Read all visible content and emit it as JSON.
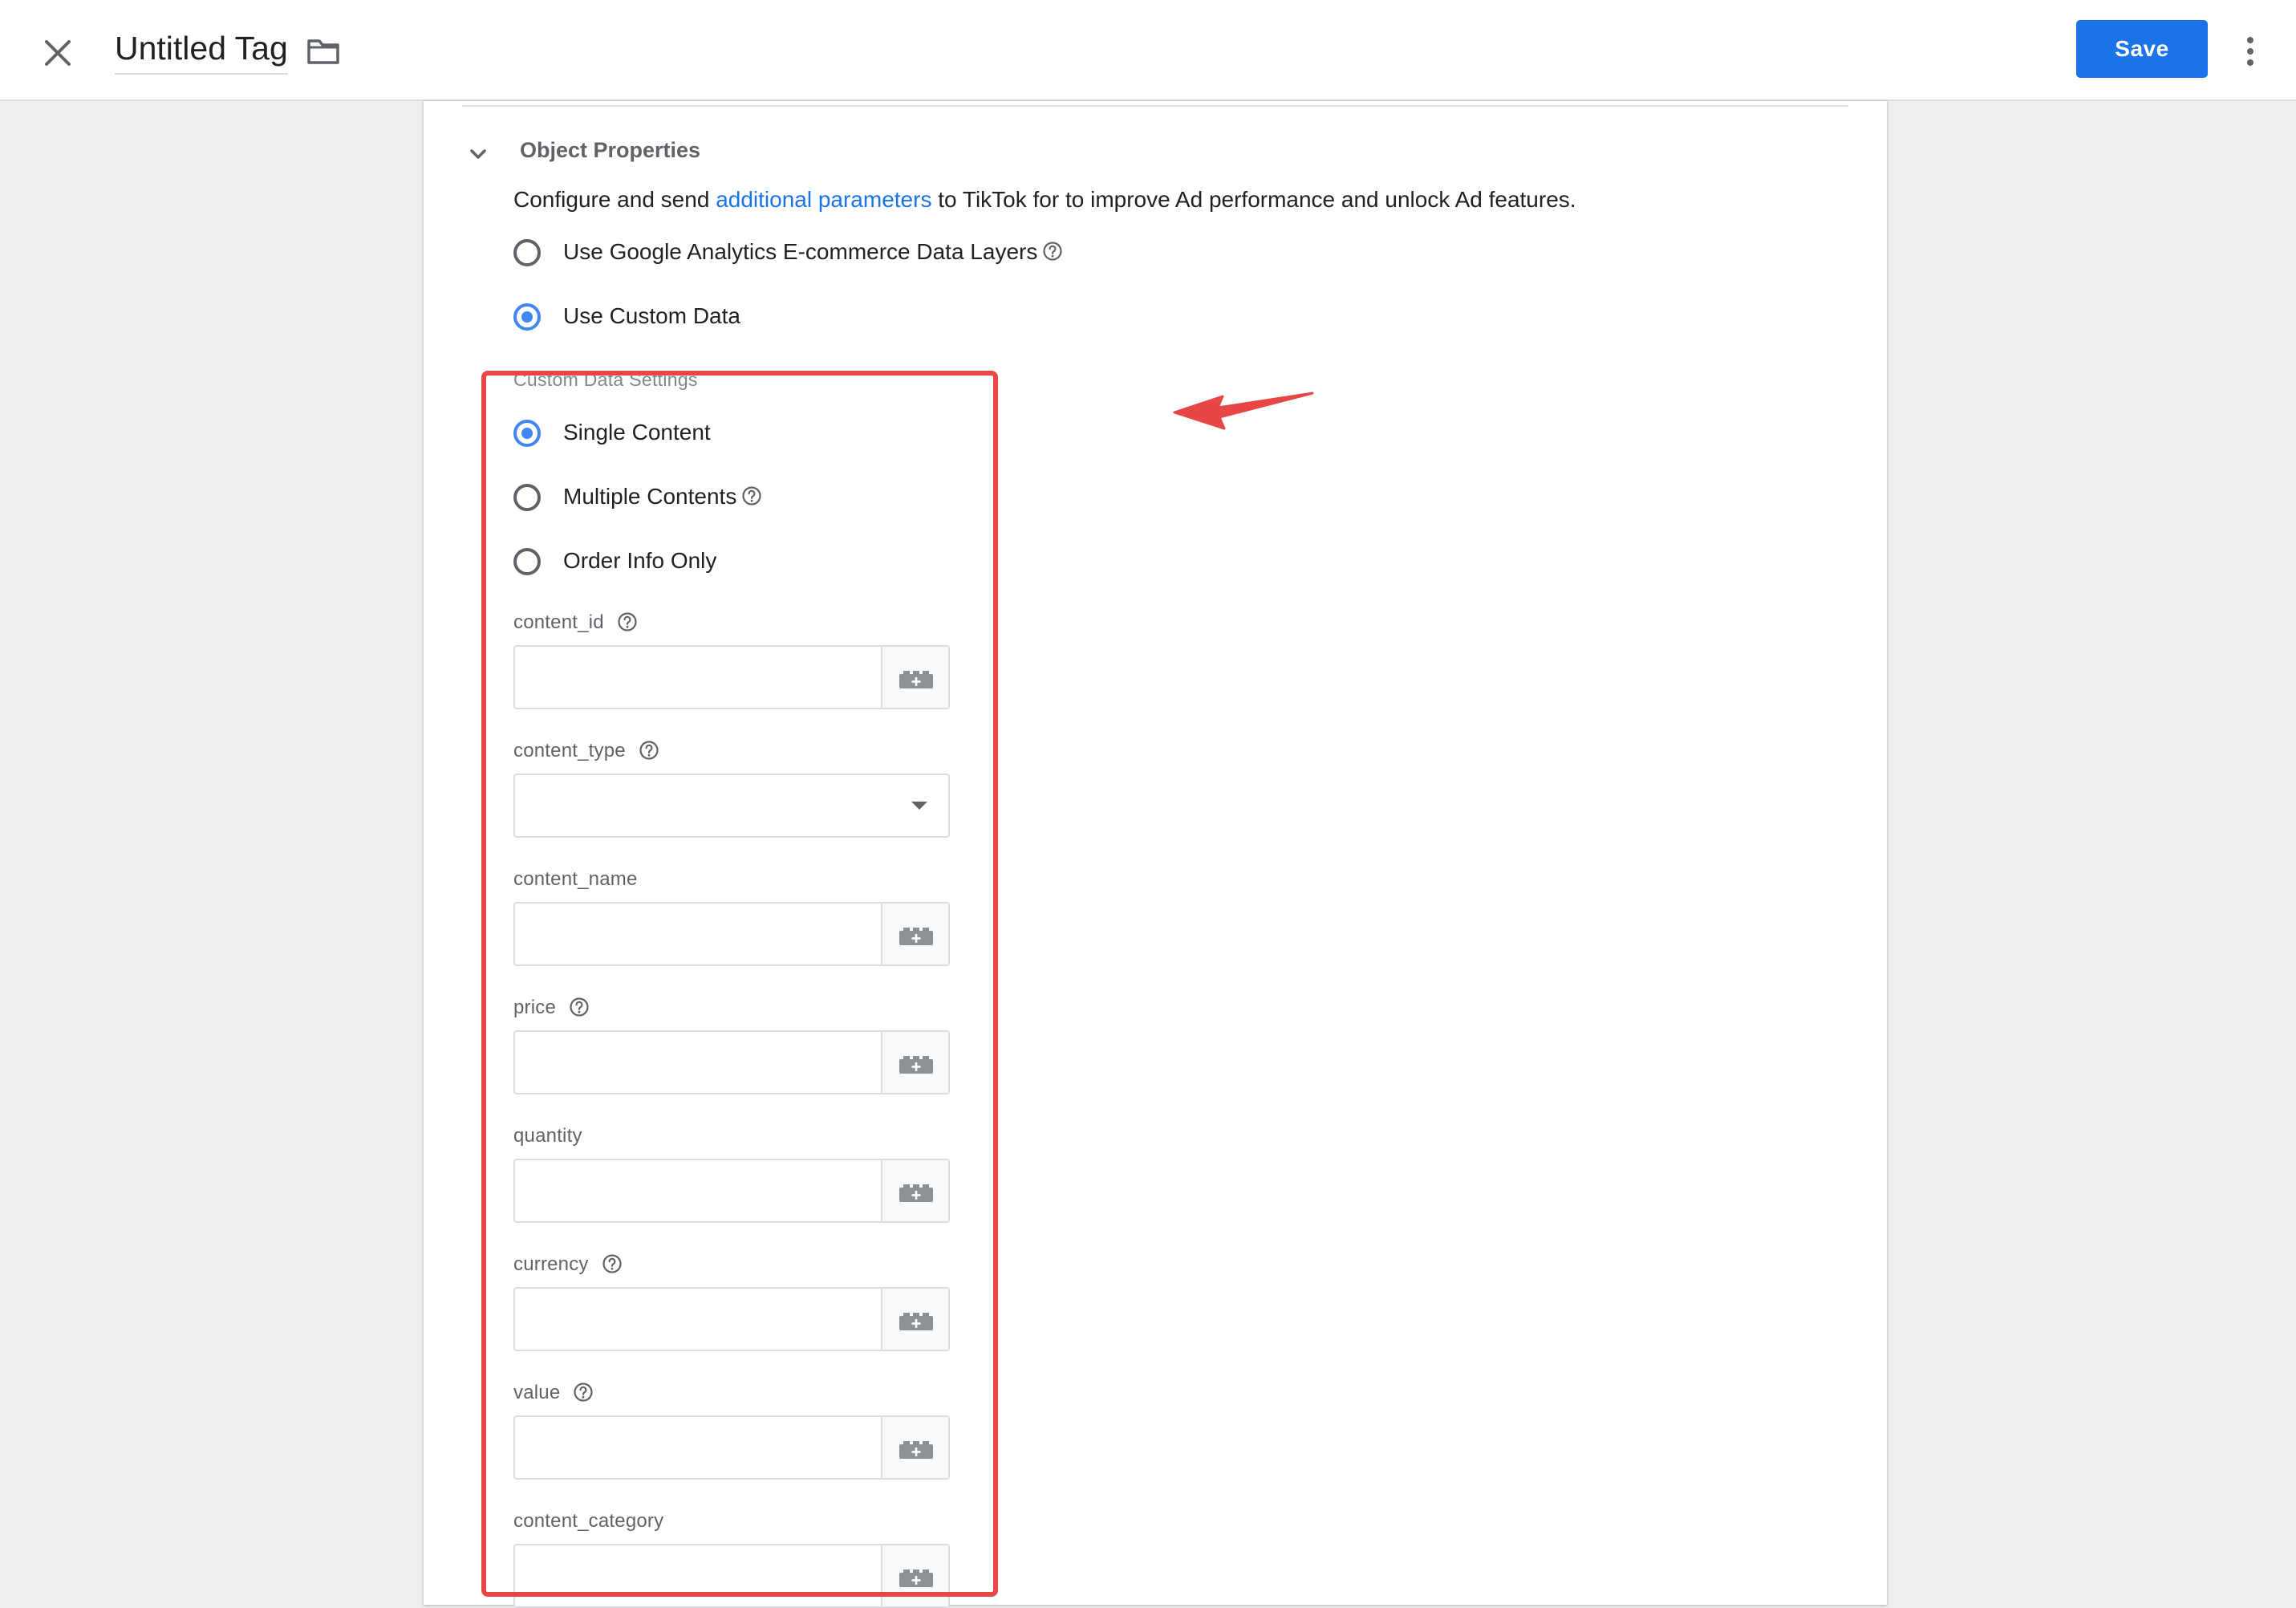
{
  "header": {
    "title": "Untitled Tag",
    "save_label": "Save",
    "icons": [
      "close-icon",
      "folder-icon",
      "more-vert-icon"
    ]
  },
  "section": {
    "title": "Object Properties",
    "expanded": true,
    "description": {
      "before": "Configure and send ",
      "link": "additional parameters",
      "after": " to TikTok for to improve Ad performance and unlock Ad features."
    },
    "data_source_options": [
      {
        "label": "Use Google Analytics E-commerce Data Layers",
        "selected": false,
        "has_help": true
      },
      {
        "label": "Use Custom Data",
        "selected": true,
        "has_help": false
      }
    ]
  },
  "custom_data": {
    "group_label": "Custom Data Settings",
    "content_options": [
      {
        "label": "Single Content",
        "selected": true,
        "has_help": false
      },
      {
        "label": "Multiple Contents",
        "selected": false,
        "has_help": true
      },
      {
        "label": "Order Info Only",
        "selected": false,
        "has_help": false
      }
    ],
    "fields": [
      {
        "label": "content_id",
        "type": "text",
        "value": "",
        "has_help": true
      },
      {
        "label": "content_type",
        "type": "select",
        "value": "",
        "has_help": true
      },
      {
        "label": "content_name",
        "type": "text",
        "value": "",
        "has_help": false
      },
      {
        "label": "price",
        "type": "text",
        "value": "",
        "has_help": true
      },
      {
        "label": "quantity",
        "type": "text",
        "value": "",
        "has_help": false
      },
      {
        "label": "currency",
        "type": "text",
        "value": "",
        "has_help": true
      },
      {
        "label": "value",
        "type": "text",
        "value": "",
        "has_help": true
      },
      {
        "label": "content_category",
        "type": "text",
        "value": "",
        "has_help": false
      }
    ]
  },
  "colors": {
    "accent": "#1a73e8",
    "radio_selected": "#4285f4",
    "annotation": "#e84545",
    "background": "#eeeeee"
  }
}
